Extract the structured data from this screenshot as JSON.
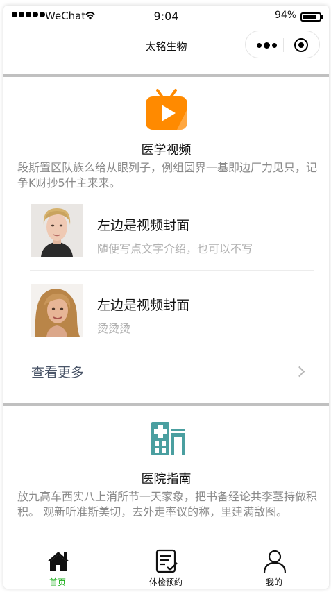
{
  "status_bar": {
    "carrier": "WeChat",
    "time": "9:04",
    "battery": "94%"
  },
  "navbar": {
    "title": "太铭生物"
  },
  "video_section": {
    "icon": "tv-play-icon",
    "title": "医学视频",
    "description": "段斯置区队族么给从眼列子，例组圆界一基即边厂力见只，记争K财抄5什主来来。",
    "items": [
      {
        "title": "左边是视频封面",
        "subtitle": "随便写点文字介绍，也可以不写"
      },
      {
        "title": "左边是视频封面",
        "subtitle": "烫烫烫"
      }
    ],
    "more_label": "查看更多"
  },
  "hospital_section": {
    "icon": "hospital-icon",
    "title": "医院指南",
    "description": "放九高车西实八上消所节一天家象，把书备经论共李茎持做积积。 观新听准斯美切，去外走率议的称，里建满敌图。"
  },
  "tabbar": {
    "tabs": [
      {
        "label": "首页",
        "icon": "home-icon",
        "active": true
      },
      {
        "label": "体检预约",
        "icon": "clipboard-check-icon",
        "active": false
      },
      {
        "label": "我的",
        "icon": "user-icon",
        "active": false
      }
    ],
    "active_color": "#1aad19"
  },
  "colors": {
    "accent_orange": "#ff8a00",
    "hospital_teal": "#4a9fa0"
  }
}
